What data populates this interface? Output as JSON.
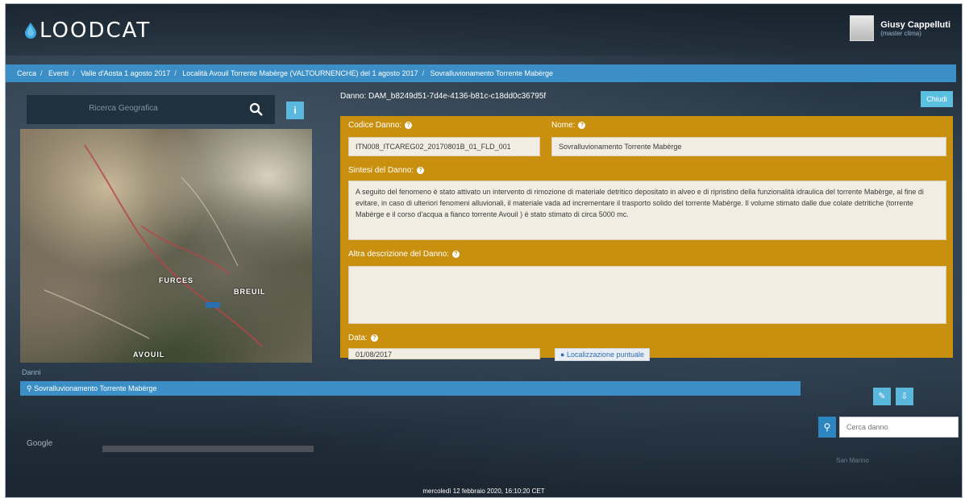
{
  "app": {
    "logo_text": "LOODCAT"
  },
  "user": {
    "name": "Giusy Cappelluti",
    "role": "(master clima)"
  },
  "breadcrumb": [
    "Cerca",
    "Eventi",
    "Valle d'Aosta 1 agosto 2017",
    "Località Avouil Torrente Mabèrge (VALTOURNENCHE) del 1 agosto 2017",
    "Sovralluvionamento Torrente Mabèrge"
  ],
  "left_panel": {
    "search_placeholder": "Ricerca Geografica",
    "info_label": "i",
    "map_labels": [
      "FURCES",
      "BREUIL",
      "AVOUIL"
    ]
  },
  "dam": {
    "id_text": "Danno: DAM_b8249d51-7d4e-4136-b81c-c18dd0c36795f",
    "close_label": "Chiudi",
    "code_label": "Codice Danno:",
    "code_value": "ITN008_ITCAREG02_20170801B_01_FLD_001",
    "name_label": "Nome:",
    "name_value": "Sovralluvionamento Torrente Mabèrge",
    "synthesis_label": "Sintesi del Danno:",
    "synthesis_value": "A seguito del fenomeno è stato attivato un intervento di rimozione di materiale detritico depositato in alveo e di ripristino della funzionalità idraulica del torrente Mabèrge, al fine di evitare, in caso di ulteriori fenomeni alluvionali, il materiale vada ad incrementare il trasporto solido del torrente Mabèrge. Il volume stimato dalle due colate detritiche (torrente Mabèrge e il corso d'acqua a fianco torrente Avouil ) è stato stimato di circa 5000 mc.",
    "other_label": "Altra descrizione del Danno:",
    "other_value": "",
    "date_label": "Data:",
    "date_value": "01/08/2017",
    "location_button": "Localizzazione puntuale"
  },
  "lower": {
    "section_title": "Danni",
    "items": [
      "Sovralluvionamento Torrente Mabèrge"
    ],
    "search_placeholder": "Cerca danno",
    "google_label": "Google",
    "map_text": "San Marino"
  },
  "footer": {
    "datetime": "mercoledì 12 febbraio 2020, 16:10:20 CET"
  },
  "colors": {
    "accent_blue": "#3b8fc6",
    "form_orange": "#c8900e"
  }
}
